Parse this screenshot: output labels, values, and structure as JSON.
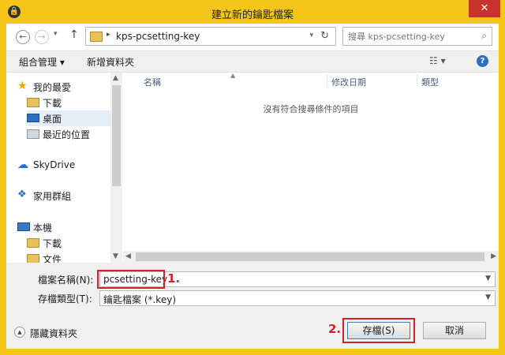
{
  "window": {
    "title": "建立新的鑰匙檔案",
    "close_symbol": "✕",
    "app_icon": "lock-icon"
  },
  "address": {
    "back_symbol": "←",
    "forward_symbol": "→",
    "history_dd_symbol": "▾",
    "up_symbol": "↑",
    "breadcrumb_arrow": "▸",
    "path": "kps-pcsetting-key",
    "refresh_symbol": "↻"
  },
  "search": {
    "placeholder": "搜尋 kps-pcsetting-key",
    "icon": "search-icon"
  },
  "toolbar": {
    "organize": "組合管理 ▾",
    "new_folder": "新增資料夾",
    "view_symbol": "☷ ▾",
    "help_symbol": "?"
  },
  "nav": {
    "favorites": "我的最愛",
    "downloads": "下載",
    "desktop": "桌面",
    "recent": "最近的位置",
    "skydrive": "SkyDrive",
    "homegroup": "家用群組",
    "thispc": "本機",
    "pc_downloads": "下載",
    "pc_documents": "文件"
  },
  "filelist": {
    "columns": [
      "名稱",
      "修改日期",
      "類型"
    ],
    "empty_message": "沒有符合搜尋條件的項目"
  },
  "form": {
    "filename_label": "檔案名稱(N):",
    "filename_value": "pcsetting-key",
    "filetype_label": "存檔類型(T):",
    "filetype_value": "鑰匙檔案 (*.key)",
    "hide_folders": "隱藏資料夾",
    "save_label": "存檔(S)",
    "cancel_label": "取消"
  },
  "annotations": {
    "step1": "1.",
    "step2": "2."
  },
  "colors": {
    "title_bar": "#f5c518",
    "close_button": "#c7322b",
    "annotation_red": "#d8202a",
    "selection": "#e5eef7"
  }
}
